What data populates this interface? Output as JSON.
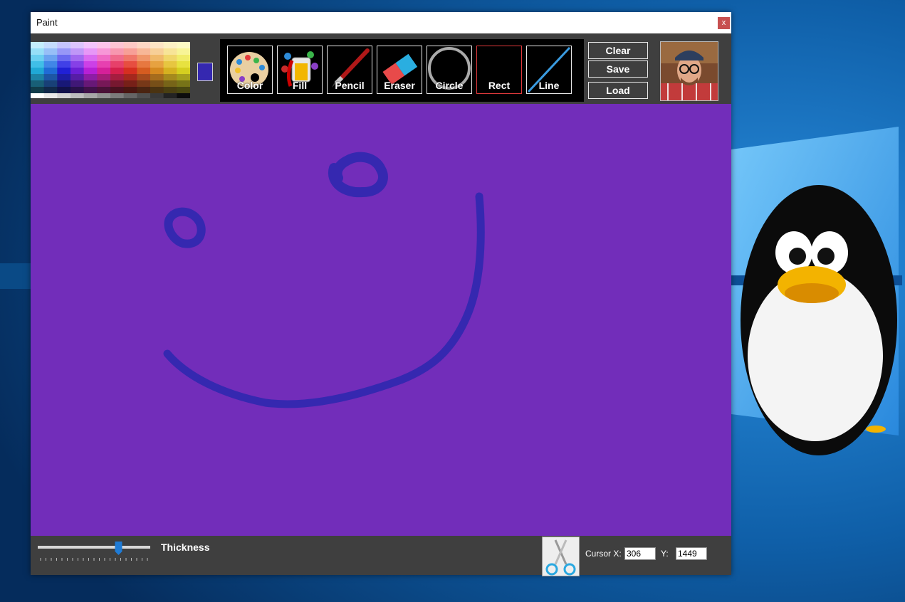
{
  "window": {
    "title": "Paint",
    "close_label": "x"
  },
  "current_color": "#3528b0",
  "tools": [
    {
      "label": "Color",
      "icon": "palette-icon"
    },
    {
      "label": "Fill",
      "icon": "paint-bucket-icon"
    },
    {
      "label": "Pencil",
      "icon": "brush-icon"
    },
    {
      "label": "Eraser",
      "icon": "eraser-icon"
    },
    {
      "label": "Circle",
      "icon": "circle-icon"
    },
    {
      "label": "Rect",
      "icon": "rectangle-icon",
      "active": true
    },
    {
      "label": "Line",
      "icon": "line-icon"
    }
  ],
  "actions": {
    "clear": "Clear",
    "save": "Save",
    "load": "Load"
  },
  "canvas": {
    "background": "#722dba",
    "stroke_color": "#3528b0"
  },
  "bottom": {
    "thickness_label": "Thickness",
    "thickness_level": 0.73,
    "cursor_x_label": "Cursor X:",
    "cursor_x_value": "306",
    "cursor_y_label": "Y:",
    "cursor_y_value": "1449"
  }
}
